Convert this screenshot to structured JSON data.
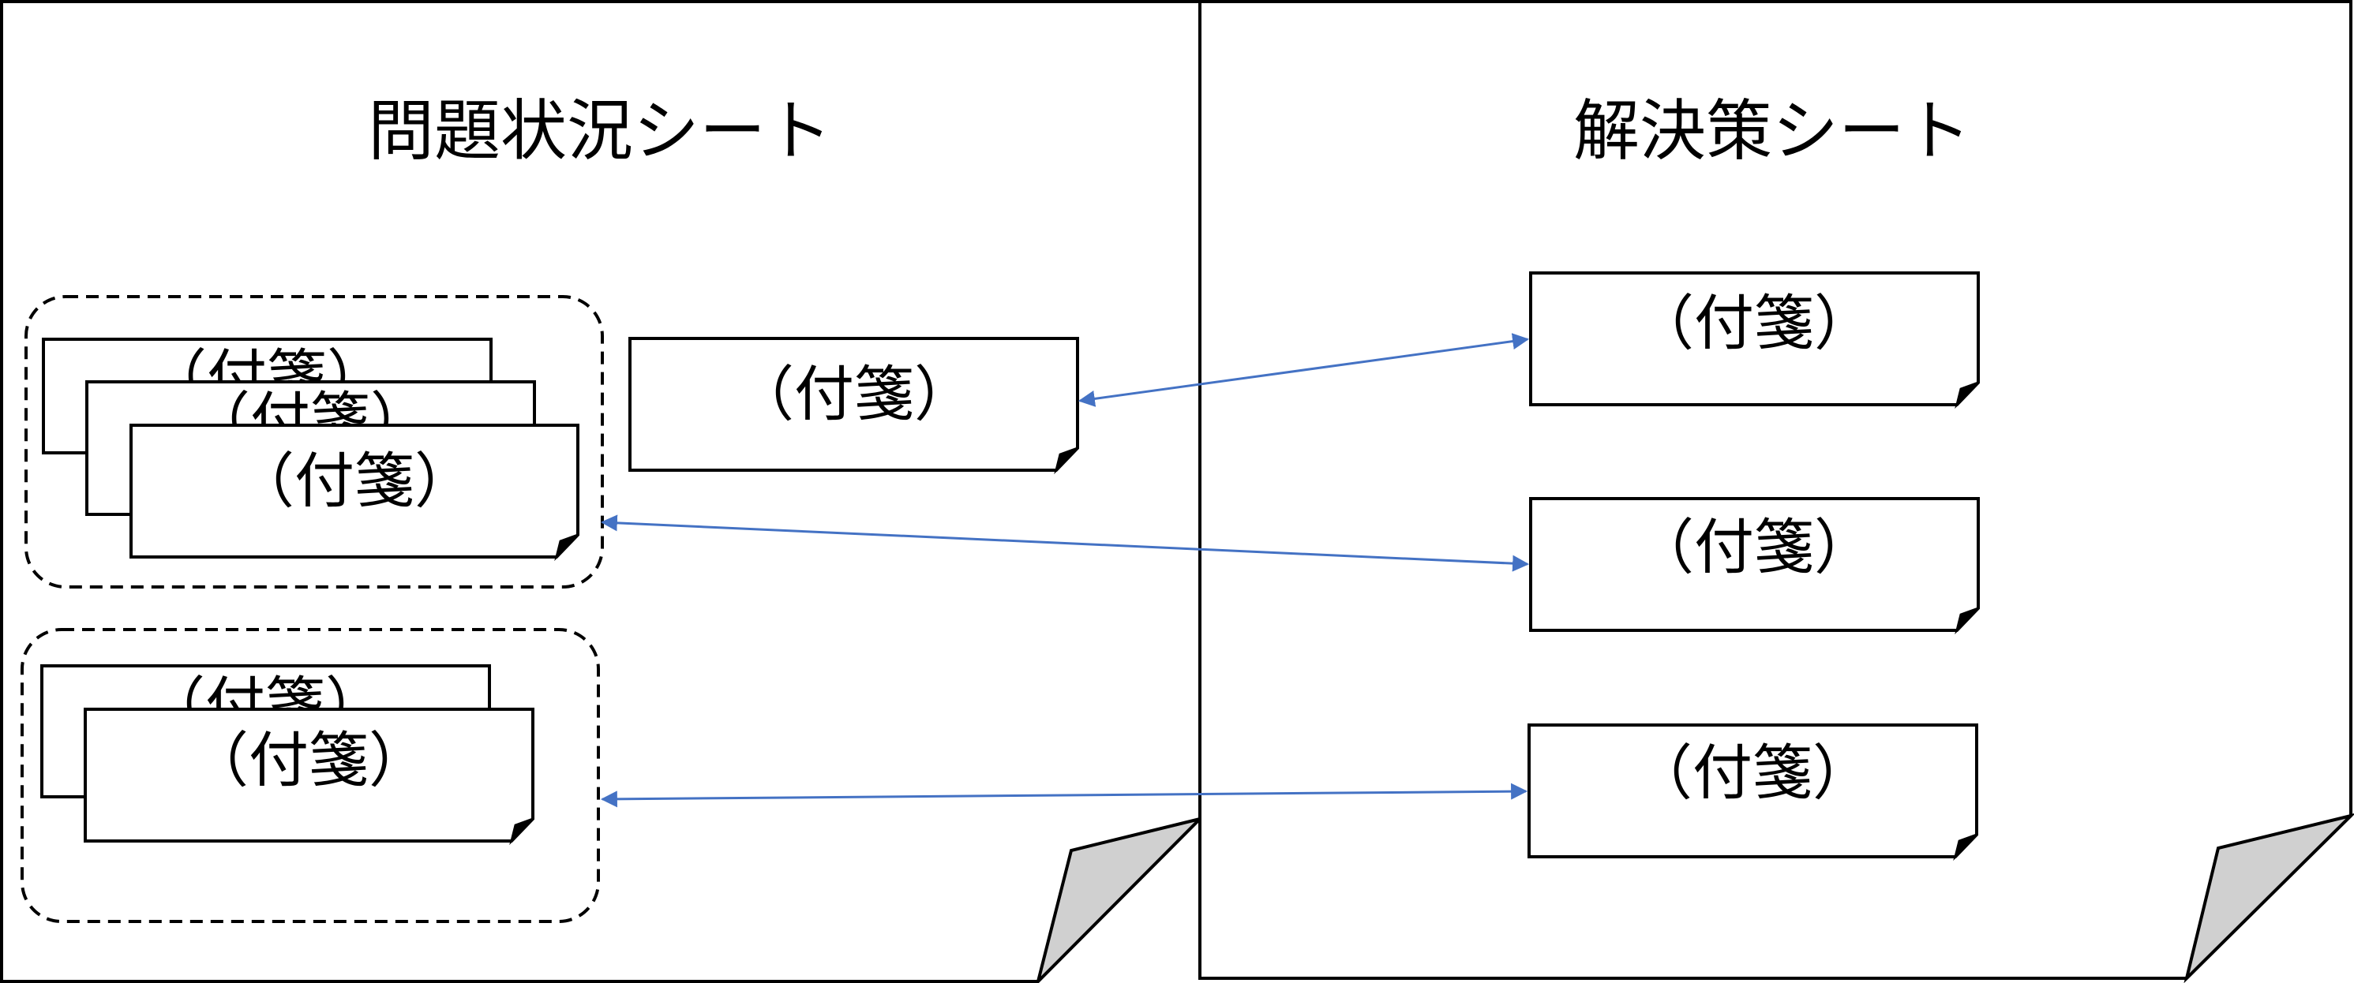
{
  "sheets": {
    "problem": {
      "title": "問題状況シート"
    },
    "solution": {
      "title": "解決策シート"
    }
  },
  "notes": {
    "label": "（付箋）"
  },
  "colors": {
    "arrow": "#4472C4",
    "border": "#000000",
    "fold": "#D0D0D0",
    "background": "#FFFFFF"
  }
}
